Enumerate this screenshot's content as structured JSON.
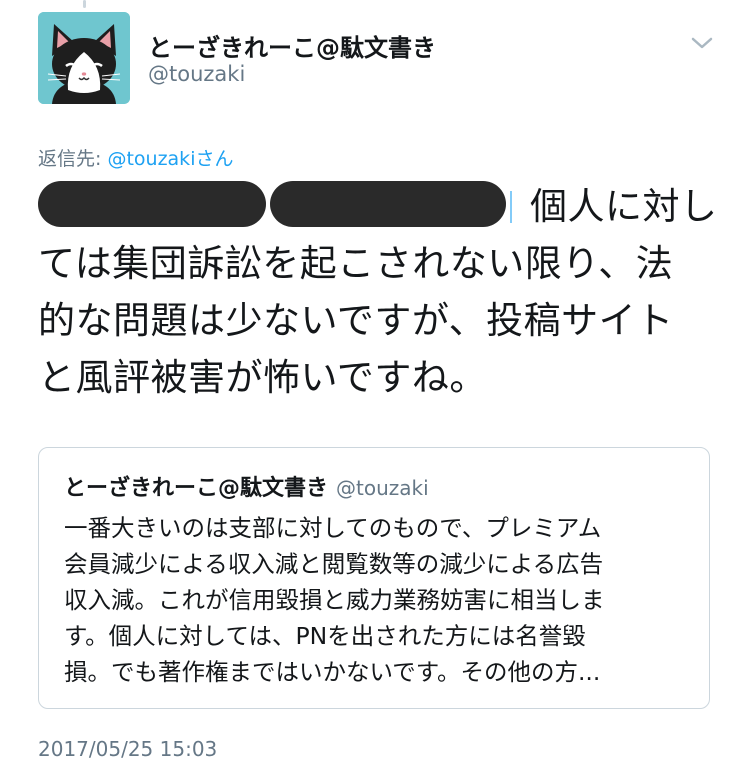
{
  "tweet": {
    "author": {
      "display_name": "とーざきれーこ@駄文書き",
      "handle": "@touzaki",
      "avatar_icon": "cat-avatar-icon"
    },
    "reply_prefix": "返信先: ",
    "reply_mention": "@touzakiさん",
    "body_lines": [
      "個人に対し",
      "ては集団訴訟を起こされない限り、法",
      "的な問題は少ないですが、投稿サイト",
      "と風評被害が怖いですね。"
    ],
    "timestamp": "2017/05/25 15:03"
  },
  "quoted_tweet": {
    "display_name": "とーざきれーこ@駄文書き",
    "handle": "@touzaki",
    "text_lines": [
      "一番大きいのは支部に対してのもので、プレミアム",
      "会員減少による収入減と閲覧数等の減少による広告",
      "収入減。これが信用毀損と威力業務妨害に相当しま",
      "す。個人に対しては、PNを出された方には名誉毀",
      "損。でも著作権まではいかないです。その他の方..."
    ]
  },
  "colors": {
    "text_primary": "#14171a",
    "text_secondary": "#657786",
    "link": "#1da1f2",
    "border": "#ccd6dd",
    "avatar_bg": "#6fc6cf",
    "redaction": "#2a2a2a"
  }
}
